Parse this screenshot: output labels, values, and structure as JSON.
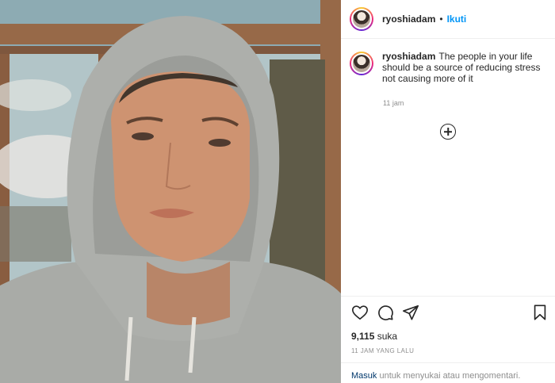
{
  "post": {
    "username": "ryoshiadam",
    "separator": "•",
    "follow_label": "Ikuti",
    "caption": "The people in your life should be a source of reducing stress not causing more of it",
    "caption_time": "11 jam",
    "likes_count": "9,115",
    "likes_suffix": "suka",
    "posted_ago": "11 JAM YANG LALU"
  },
  "footer": {
    "login_link": "Masuk",
    "login_text": "untuk menyukai atau mengomentari."
  },
  "icons": {
    "like": "heart-icon",
    "comment": "comment-icon",
    "share": "share-icon",
    "save": "bookmark-icon",
    "more": "plus-circle-icon"
  },
  "colors": {
    "accent": "#0095f6",
    "text": "#262626",
    "muted": "#8e8e8e",
    "link": "#00376b"
  }
}
